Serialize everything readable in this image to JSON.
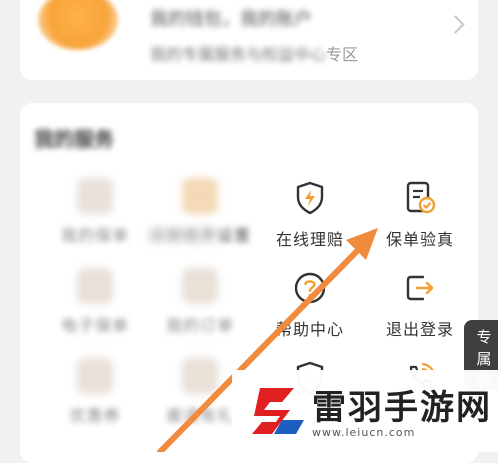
{
  "profile": {
    "name_blurred": "我的钱包，我的账户",
    "sub_blurred": "我的专属服务与权益中心",
    "sub_visible": "专区"
  },
  "section": {
    "title": "我的服务"
  },
  "grid": [
    {
      "label": "我的保单",
      "icon": "blurred-icon",
      "blurred": true
    },
    {
      "label": "续期缴费设置",
      "icon": "blurred-icon",
      "blurred": true,
      "suffix": "设置"
    },
    {
      "label": "在线理赔",
      "icon": "shield-lightning-icon",
      "blurred": false
    },
    {
      "label": "保单验真",
      "icon": "document-check-icon",
      "blurred": false
    },
    {
      "label": "电子保单",
      "icon": "blurred-icon",
      "blurred": true
    },
    {
      "label": "我的订单",
      "icon": "blurred-icon",
      "blurred": true
    },
    {
      "label": "帮助中心",
      "icon": "question-circle-icon",
      "blurred": false
    },
    {
      "label": "退出登录",
      "icon": "logout-icon",
      "blurred": false
    },
    {
      "label": "优惠券",
      "icon": "blurred-icon",
      "blurred": true
    },
    {
      "label": "邀请有礼",
      "icon": "blurred-icon",
      "blurred": true
    },
    {
      "label": "",
      "icon": "warning-shield-icon",
      "blurred": false
    },
    {
      "label": "",
      "icon": "phone-icon",
      "blurred": false
    }
  ],
  "side_tab": {
    "label": "专属管"
  },
  "watermark": {
    "brand": "雷羽手游网",
    "url": "www.leiucn.com"
  },
  "colors": {
    "accent": "#f08a3c",
    "icon_orange": "#f0a030",
    "text": "#333333"
  }
}
